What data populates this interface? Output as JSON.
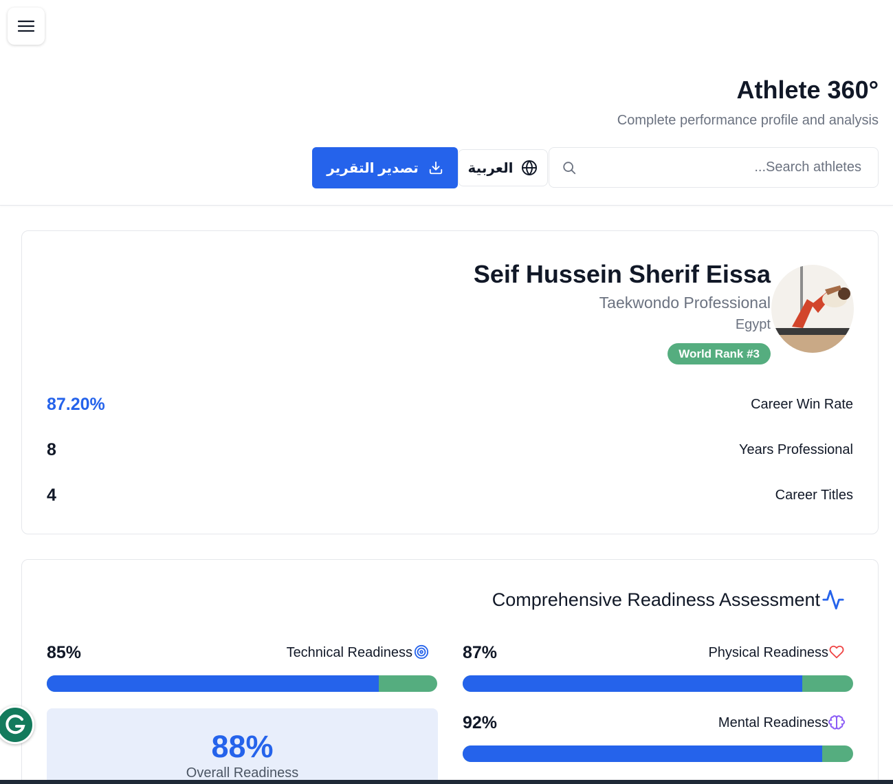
{
  "header": {
    "title": "Athlete 360°",
    "subtitle": "Complete performance profile and analysis",
    "search_placeholder": "Search athletes...",
    "language_label": "العربية",
    "export_label": "تصدير التقرير"
  },
  "icons": {
    "menu": "menu-icon",
    "search": "search-icon",
    "language": "globe-icon",
    "export": "download-icon",
    "assessment": "activity-icon",
    "technical": "target-icon",
    "physical": "heart-icon",
    "mental": "brain-icon",
    "extension": "grammarly-icon"
  },
  "profile": {
    "name": "Seif Hussein Sherif Eissa",
    "sport": "Taekwondo Professional",
    "country": "Egypt",
    "rank_badge": "World Rank #3",
    "stats": [
      {
        "label": "Career Win Rate",
        "value": "87.20%"
      },
      {
        "label": "Years Professional",
        "value": "8"
      },
      {
        "label": "Career Titles",
        "value": "4"
      }
    ]
  },
  "readiness": {
    "title": "Comprehensive Readiness Assessment",
    "metrics": [
      {
        "label": "Technical Readiness",
        "value": "85%",
        "fraction": 0.85
      },
      {
        "label": "Physical Readiness",
        "value": "87%",
        "fraction": 0.87
      },
      {
        "label": "Mental Readiness",
        "value": "92%",
        "fraction": 0.92
      }
    ],
    "overall": {
      "value": "88%",
      "label": "Overall Readiness"
    }
  },
  "colors": {
    "primary": "#2563eb",
    "success": "#55ad7f",
    "heart": "#ef4444",
    "brain": "#8b5cf6",
    "extension": "#137a5c"
  }
}
